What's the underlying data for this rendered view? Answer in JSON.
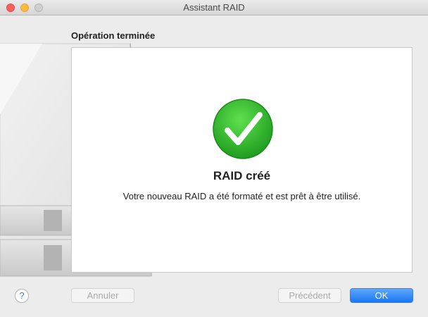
{
  "window": {
    "title": "Assistant RAID"
  },
  "step": {
    "heading": "Opération terminée"
  },
  "result": {
    "icon": "checkmark-success-icon",
    "title": "RAID créé",
    "message": "Votre nouveau RAID a été formaté et est prêt à être utilisé."
  },
  "footer": {
    "help_label": "?",
    "cancel_label": "Annuler",
    "previous_label": "Précédent",
    "ok_label": "OK"
  },
  "colors": {
    "accent": "#1978f5",
    "success": "#2fb52f"
  }
}
